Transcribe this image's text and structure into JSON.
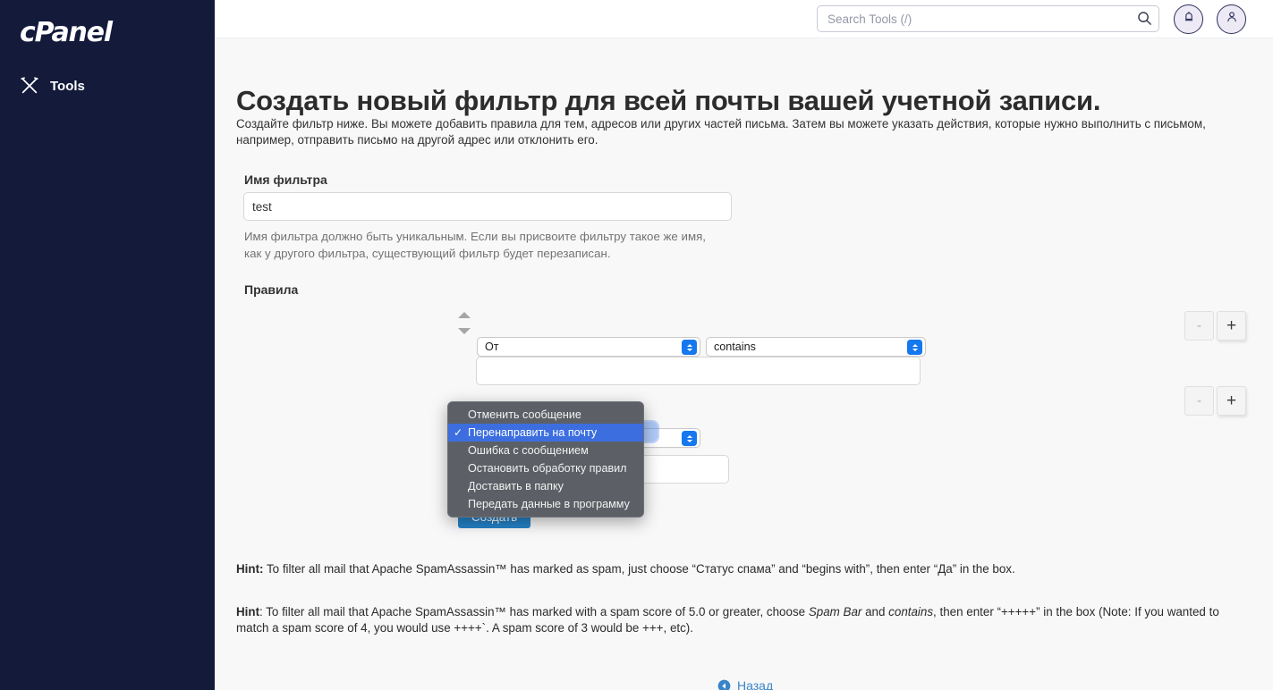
{
  "sidebar": {
    "logo_text": "cPanel",
    "nav_items": [
      {
        "label": "Tools",
        "icon": "tools-icon"
      }
    ]
  },
  "header": {
    "search": {
      "placeholder": "Search Tools (/)",
      "value": "",
      "icon": "search-icon"
    },
    "notifications_icon": "bell-icon",
    "account_icon": "user-icon"
  },
  "main": {
    "title": "Создать новый фильтр для всей почты вашей учетной записи.",
    "description": "Создайте фильтр ниже. Вы можете добавить правила для тем, адресов или других частей письма. Затем вы можете указать действия, которые нужно выполнить с письмом, например, отправить письмо на другой адрес или отклонить его.",
    "filter_name": {
      "label": "Имя фильтра",
      "value": "test",
      "placeholder": "",
      "help": "Имя фильтра должно быть уникальным. Если вы присвоите фильтру такое же имя, как у другого фильтра, существующий фильтр будет перезаписан."
    },
    "rules": {
      "label": "Правила",
      "row": {
        "field_value": "От",
        "operator_value": "contains",
        "input_value": "",
        "input_placeholder": "",
        "move_up_icon": "triangle-up-icon",
        "move_down_icon": "triangle-down-icon"
      }
    },
    "actions": {
      "row": {
        "action_value": "Перенаправить на почту",
        "input_value": "",
        "input_placeholder": ""
      }
    },
    "row_buttons": {
      "remove_label": "-",
      "add_label": "+"
    },
    "submit_label": "Создать",
    "hints": [
      {
        "lead": "Hint:",
        "segments": [
          {
            "text": " To filter all mail that Apache SpamAssassin™ has marked as spam, just choose “",
            "style": "normal"
          },
          {
            "text": "Статус спама",
            "style": "normal"
          },
          {
            "text": "” and “begins with”, then enter “",
            "style": "normal"
          },
          {
            "text": "Да",
            "style": "normal"
          },
          {
            "text": "” in the box.",
            "style": "normal"
          }
        ],
        "plain": " To filter all mail that Apache SpamAssassin™ has marked as spam, just choose “Статус спама” and “begins with”, then enter “Да” in the box."
      },
      {
        "lead": "Hint",
        "part1": ": To filter all mail that Apache SpamAssassin™ has marked with a spam score of 5.0 or greater, choose ",
        "italic1": "Spam Bar",
        "part2": " and ",
        "italic2": "contains",
        "part3": ", then enter “+++++” in the box (Note: If you wanted to match a spam score of 4, you would use ++++`. A spam score of 3 would be +++, etc)."
      }
    ],
    "back_link": {
      "label": "Назад",
      "icon": "circle-arrow-left-icon"
    }
  },
  "dropdown": {
    "open": true,
    "selected_index": 1,
    "check_glyph": "✓",
    "items": [
      {
        "label": "Отменить сообщение"
      },
      {
        "label": "Перенаправить на почту"
      },
      {
        "label": "Ошибка с сообщением"
      },
      {
        "label": "Остановить обработку правил"
      },
      {
        "label": "Доставить в папку"
      },
      {
        "label": "Передать данные в программу"
      }
    ]
  },
  "colors": {
    "sidebar_bg": "#131a3a",
    "accent_blue": "#2582c8",
    "select_blue": "#1678ef",
    "highlight_blue": "#3c6ee0",
    "content_bg": "#f8f8f9"
  }
}
